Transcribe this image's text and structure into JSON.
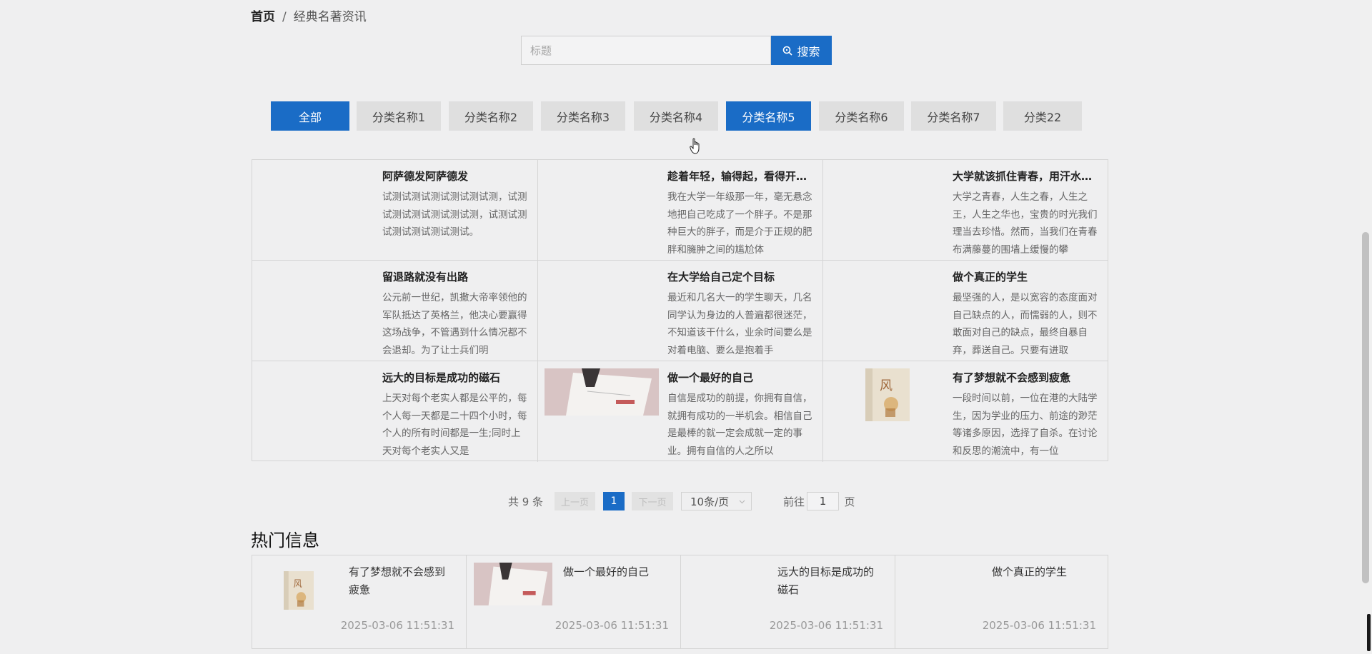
{
  "breadcrumb": {
    "home": "首页",
    "sep": "/",
    "current": "经典名著资讯"
  },
  "search": {
    "placeholder": "标题",
    "value": "",
    "button": "搜索"
  },
  "categories": [
    {
      "label": "全部",
      "active": true
    },
    {
      "label": "分类名称1",
      "active": false
    },
    {
      "label": "分类名称2",
      "active": false
    },
    {
      "label": "分类名称3",
      "active": false
    },
    {
      "label": "分类名称4",
      "active": false
    },
    {
      "label": "分类名称5",
      "active": true
    },
    {
      "label": "分类名称6",
      "active": false
    },
    {
      "label": "分类名称7",
      "active": false
    },
    {
      "label": "分类22",
      "active": false
    }
  ],
  "articles": [
    {
      "title": "阿萨德发阿萨德发",
      "desc": "试测试测试测试测试测试测，试测试测试测试测试测试测，试测试测试测试测试测试测试。",
      "image": ""
    },
    {
      "title": "趁着年轻，输得起，看得开…",
      "desc": "我在大学一年级那一年，毫无悬念地把自己吃成了一个胖子。不是那种巨大的胖子，而是介于正规的肥胖和臃肿之间的尴尬体",
      "image": ""
    },
    {
      "title": "大学就该抓住青春，用汗水…",
      "desc": "大学之青春，人生之春，人生之王，人生之华也，宝贵的时光我们理当去珍惜。然而，当我们在青春布满藤蔓的围墙上缓慢的攀",
      "image": ""
    },
    {
      "title": "留退路就没有出路",
      "desc": "公元前一世纪，凯撒大帝率领他的军队抵达了英格兰，他决心要赢得这场战争，不管遇到什么情况都不会退却。为了让士兵们明",
      "image": ""
    },
    {
      "title": "在大学给自己定个目标",
      "desc": "最近和几名大一的学生聊天，几名同学认为身边的人普遍都很迷茫，不知道该干什么，业余时间要么是对着电脑、要么是抱着手",
      "image": ""
    },
    {
      "title": "做个真正的学生",
      "desc": "最坚强的人，是以宽容的态度面对自己缺点的人，而懦弱的人，则不敢面对自己的缺点，最终自暴自弃，葬送自己。只要有进取",
      "image": ""
    },
    {
      "title": "远大的目标是成功的磁石",
      "desc": "上天对每个老实人都是公平的，每个人每一天都是二十四个小时，每个人的所有时间都是一生;同时上天对每个老实人又是",
      "image": ""
    },
    {
      "title": "做一个最好的自己",
      "desc": "自信是成功的前提，你拥有自信，就拥有成功的一半机会。相信自己是最棒的就一定会成就一定的事业。拥有自信的人之所以",
      "image": "book-photo"
    },
    {
      "title": "有了梦想就不会感到疲惫",
      "desc": "一段时间以前，一位在港的大陆学生，因为学业的压力、前途的渺茫等诸多原因，选择了自杀。在讨论和反思的潮流中，有一位",
      "image": "book-cover"
    }
  ],
  "pagination": {
    "total": "共 9 条",
    "prev": "上一页",
    "page": "1",
    "next": "下一页",
    "page_size": "10条/页",
    "goto": "前往",
    "goto_value": "1",
    "page_word": "页"
  },
  "hot": {
    "title": "热门信息",
    "items": [
      {
        "name": "有了梦想就不会感到疲惫",
        "date": "2025-03-06 11:51:31",
        "image": "book-cover"
      },
      {
        "name": "做一个最好的自己",
        "date": "2025-03-06 11:51:31",
        "image": "book-photo"
      },
      {
        "name": "远大的目标是成功的磁石",
        "date": "2025-03-06 11:51:31",
        "image": ""
      },
      {
        "name": "做个真正的学生",
        "date": "2025-03-06 11:51:31",
        "image": ""
      }
    ]
  },
  "colors": {
    "accent": "#1a6cc6",
    "tab_idle": "#dfdfdf",
    "border": "#d5d5d5"
  }
}
